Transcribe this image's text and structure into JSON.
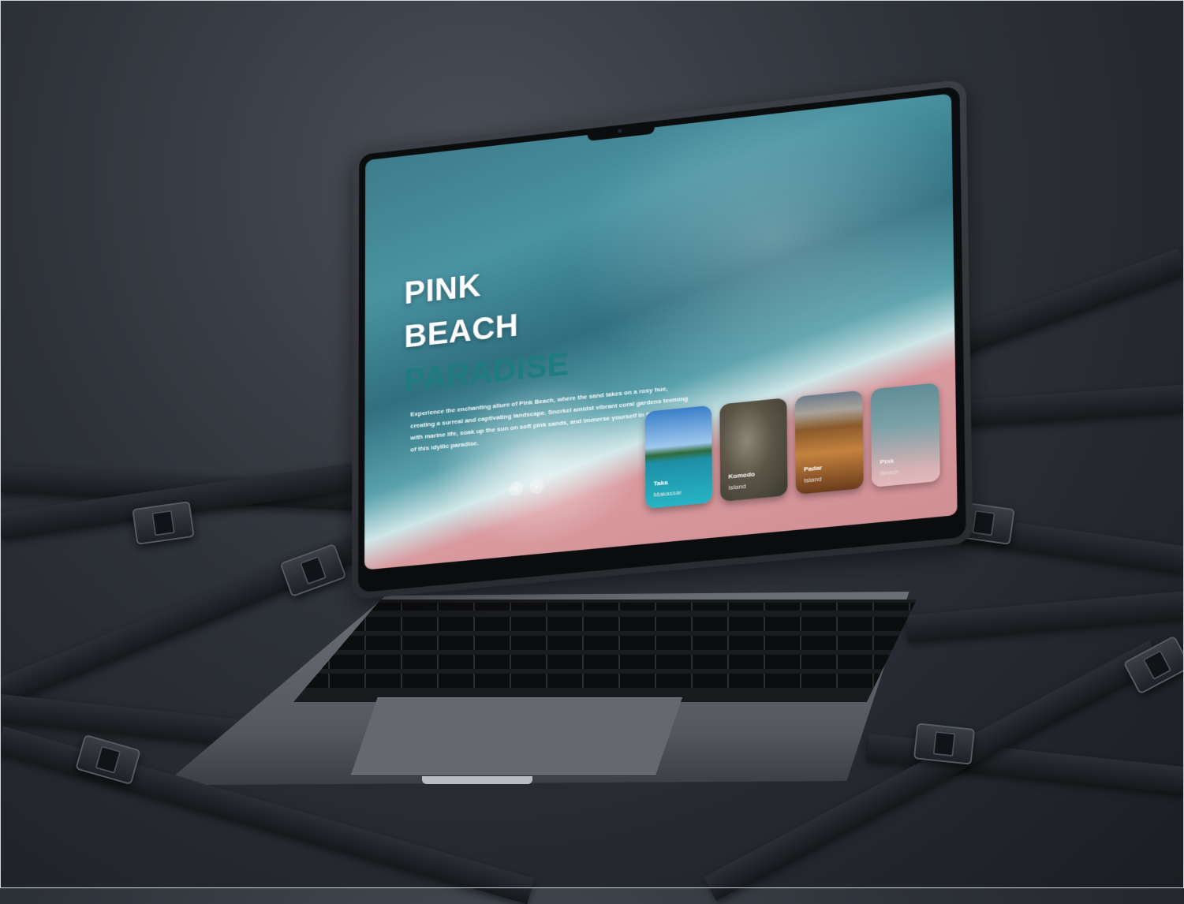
{
  "hero": {
    "line1": "PINK",
    "line2": "BEACH",
    "line3": "PARADISE",
    "description": "Experience the enchanting allure of Pink Beach, where the sand takes on a rosy hue, creating a surreal and captivating landscape. Snorkel amidst vibrant coral gardens teeming with marine life, soak up the sun on soft pink sands, and immerse yourself in the tranquility of this idyllic paradise."
  },
  "nav": {
    "prev_icon": "‹",
    "next_icon": "›"
  },
  "cards": [
    {
      "title": "Taka",
      "subtitle": "Makassar"
    },
    {
      "title": "Komodo",
      "subtitle": "Island"
    },
    {
      "title": "Padar",
      "subtitle": "Island"
    },
    {
      "title": "Pink",
      "subtitle": "Beach"
    }
  ],
  "colors": {
    "accent_teal": "#1e7c7e",
    "sand_pink": "#cf8f94"
  }
}
